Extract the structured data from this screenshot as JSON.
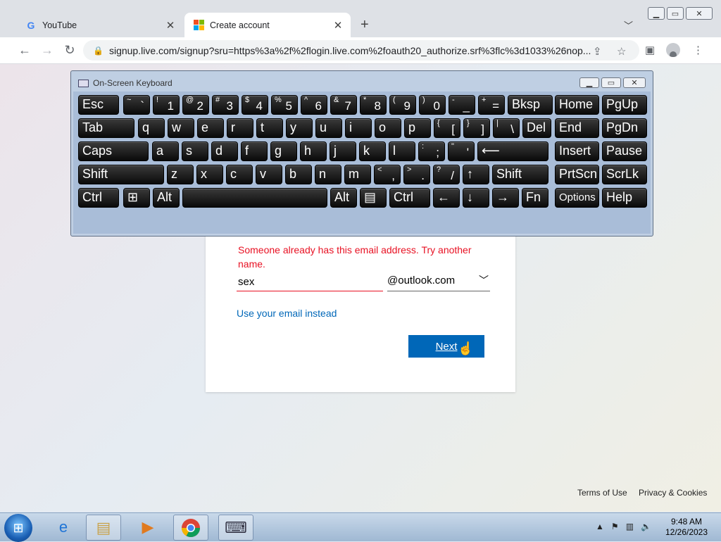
{
  "browser": {
    "tabs": [
      {
        "title": "YouTube",
        "favicon": "google-icon"
      },
      {
        "title": "Create account",
        "favicon": "microsoft-icon",
        "active": true
      }
    ],
    "url": "signup.live.com/signup?sru=https%3a%2f%2flogin.live.com%2foauth20_authorize.srf%3flc%3d1033%26nop..."
  },
  "osk": {
    "title": "On-Screen Keyboard",
    "rows": [
      [
        {
          "label": "Esc"
        },
        {
          "shift": "~",
          "main": "`"
        },
        {
          "shift": "!",
          "main": "1"
        },
        {
          "shift": "@",
          "main": "2"
        },
        {
          "shift": "#",
          "main": "3"
        },
        {
          "shift": "$",
          "main": "4"
        },
        {
          "shift": "%",
          "main": "5"
        },
        {
          "shift": "^",
          "main": "6"
        },
        {
          "shift": "&",
          "main": "7"
        },
        {
          "shift": "*",
          "main": "8"
        },
        {
          "shift": "(",
          "main": "9"
        },
        {
          "shift": ")",
          "main": "0"
        },
        {
          "shift": "-",
          "main": "_"
        },
        {
          "shift": "+",
          "main": "="
        },
        {
          "label": "Bksp"
        },
        {
          "label": "Home"
        },
        {
          "label": "PgUp"
        }
      ],
      [
        {
          "label": "Tab"
        },
        {
          "label": "q"
        },
        {
          "label": "w"
        },
        {
          "label": "e"
        },
        {
          "label": "r"
        },
        {
          "label": "t"
        },
        {
          "label": "y"
        },
        {
          "label": "u"
        },
        {
          "label": "i"
        },
        {
          "label": "o"
        },
        {
          "label": "p"
        },
        {
          "shift": "{",
          "main": "["
        },
        {
          "shift": "}",
          "main": "]"
        },
        {
          "shift": "|",
          "main": "\\"
        },
        {
          "label": "Del"
        },
        {
          "label": "End"
        },
        {
          "label": "PgDn"
        }
      ],
      [
        {
          "label": "Caps"
        },
        {
          "label": "a"
        },
        {
          "label": "s"
        },
        {
          "label": "d"
        },
        {
          "label": "f"
        },
        {
          "label": "g"
        },
        {
          "label": "h"
        },
        {
          "label": "j"
        },
        {
          "label": "k"
        },
        {
          "label": "l"
        },
        {
          "shift": ":",
          "main": ";"
        },
        {
          "shift": "\"",
          "main": "'"
        },
        {
          "label": "⟵"
        },
        {
          "label": "Insert"
        },
        {
          "label": "Pause"
        }
      ],
      [
        {
          "label": "Shift"
        },
        {
          "label": "z"
        },
        {
          "label": "x"
        },
        {
          "label": "c"
        },
        {
          "label": "v"
        },
        {
          "label": "b"
        },
        {
          "label": "n"
        },
        {
          "label": "m"
        },
        {
          "shift": "<",
          "main": ","
        },
        {
          "shift": ">",
          "main": "."
        },
        {
          "shift": "?",
          "main": "/"
        },
        {
          "label": "↑"
        },
        {
          "label": "Shift"
        },
        {
          "label": "PrtScn"
        },
        {
          "label": "ScrLk"
        }
      ],
      [
        {
          "label": "Ctrl"
        },
        {
          "label": "⊞"
        },
        {
          "label": "Alt"
        },
        {
          "label": ""
        },
        {
          "label": "Alt"
        },
        {
          "label": "▤"
        },
        {
          "label": "Ctrl"
        },
        {
          "label": "←"
        },
        {
          "label": "↓"
        },
        {
          "label": "→"
        },
        {
          "label": "Fn"
        },
        {
          "label": "Options"
        },
        {
          "label": "Help"
        }
      ]
    ]
  },
  "signup": {
    "error": "Someone already has this email address. Try another name.",
    "email_value": "sex",
    "domain": "@outlook.com",
    "alt_link": "Use your email instead",
    "next_label": "Next"
  },
  "footer": {
    "terms": "Terms of Use",
    "privacy": "Privacy & Cookies"
  },
  "taskbar": {
    "time": "9:48 AM",
    "date": "12/26/2023"
  }
}
